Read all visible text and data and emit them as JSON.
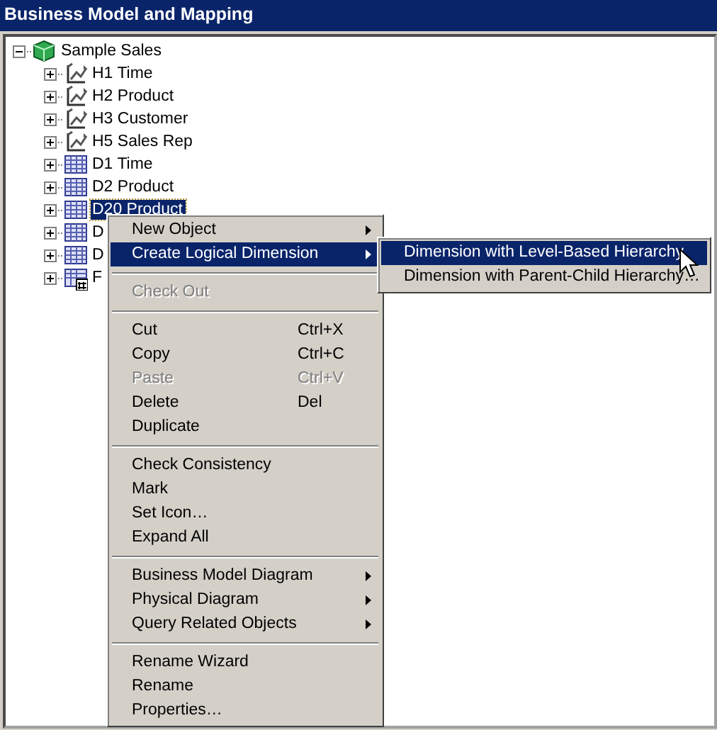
{
  "panel": {
    "title": "Business Model and Mapping"
  },
  "tree": [
    {
      "label": "Sample Sales",
      "kind": "model",
      "expanded": true,
      "selected": false,
      "children": [
        {
          "label": "H1 Time",
          "kind": "hierarchy",
          "expanded": false,
          "selected": false
        },
        {
          "label": "H2 Product",
          "kind": "hierarchy",
          "expanded": false,
          "selected": false
        },
        {
          "label": "H3 Customer",
          "kind": "hierarchy",
          "expanded": false,
          "selected": false
        },
        {
          "label": "H5 Sales Rep",
          "kind": "hierarchy",
          "expanded": false,
          "selected": false
        },
        {
          "label": "D1 Time",
          "kind": "table",
          "expanded": false,
          "selected": false
        },
        {
          "label": "D2 Product",
          "kind": "table",
          "expanded": false,
          "selected": false
        },
        {
          "label": "D20 Product",
          "kind": "table",
          "expanded": false,
          "selected": true
        },
        {
          "label": "D",
          "kind": "table",
          "expanded": false,
          "selected": false
        },
        {
          "label": "D",
          "kind": "table",
          "expanded": false,
          "selected": false
        },
        {
          "label": "F",
          "kind": "fact",
          "expanded": false,
          "selected": false
        }
      ]
    }
  ],
  "context_menu": {
    "groups": [
      [
        {
          "label": "New Object",
          "submenu": true,
          "disabled": false,
          "selected": false
        },
        {
          "label": "Create Logical Dimension",
          "submenu": true,
          "disabled": false,
          "selected": true
        }
      ],
      [
        {
          "label": "Check Out",
          "submenu": false,
          "disabled": true,
          "selected": false
        }
      ],
      [
        {
          "label": "Cut",
          "shortcut": "Ctrl+X",
          "submenu": false,
          "disabled": false,
          "selected": false
        },
        {
          "label": "Copy",
          "shortcut": "Ctrl+C",
          "submenu": false,
          "disabled": false,
          "selected": false
        },
        {
          "label": "Paste",
          "shortcut": "Ctrl+V",
          "submenu": false,
          "disabled": true,
          "selected": false
        },
        {
          "label": "Delete",
          "shortcut": "Del",
          "submenu": false,
          "disabled": false,
          "selected": false
        },
        {
          "label": "Duplicate",
          "submenu": false,
          "disabled": false,
          "selected": false
        }
      ],
      [
        {
          "label": "Check Consistency",
          "submenu": false,
          "disabled": false,
          "selected": false
        },
        {
          "label": "Mark",
          "submenu": false,
          "disabled": false,
          "selected": false
        },
        {
          "label": "Set Icon…",
          "submenu": false,
          "disabled": false,
          "selected": false
        },
        {
          "label": "Expand All",
          "submenu": false,
          "disabled": false,
          "selected": false
        }
      ],
      [
        {
          "label": "Business Model Diagram",
          "submenu": true,
          "disabled": false,
          "selected": false
        },
        {
          "label": "Physical Diagram",
          "submenu": true,
          "disabled": false,
          "selected": false
        },
        {
          "label": "Query Related Objects",
          "submenu": true,
          "disabled": false,
          "selected": false
        }
      ],
      [
        {
          "label": "Rename Wizard",
          "submenu": false,
          "disabled": false,
          "selected": false
        },
        {
          "label": "Rename",
          "submenu": false,
          "disabled": false,
          "selected": false
        },
        {
          "label": "Properties…",
          "submenu": false,
          "disabled": false,
          "selected": false
        }
      ]
    ]
  },
  "submenu": {
    "items": [
      {
        "label": "Dimension with Level-Based Hierarchy",
        "disabled": false,
        "selected": true
      },
      {
        "label": "Dimension with Parent-Child Hierarchy…",
        "disabled": false,
        "selected": false
      }
    ]
  }
}
